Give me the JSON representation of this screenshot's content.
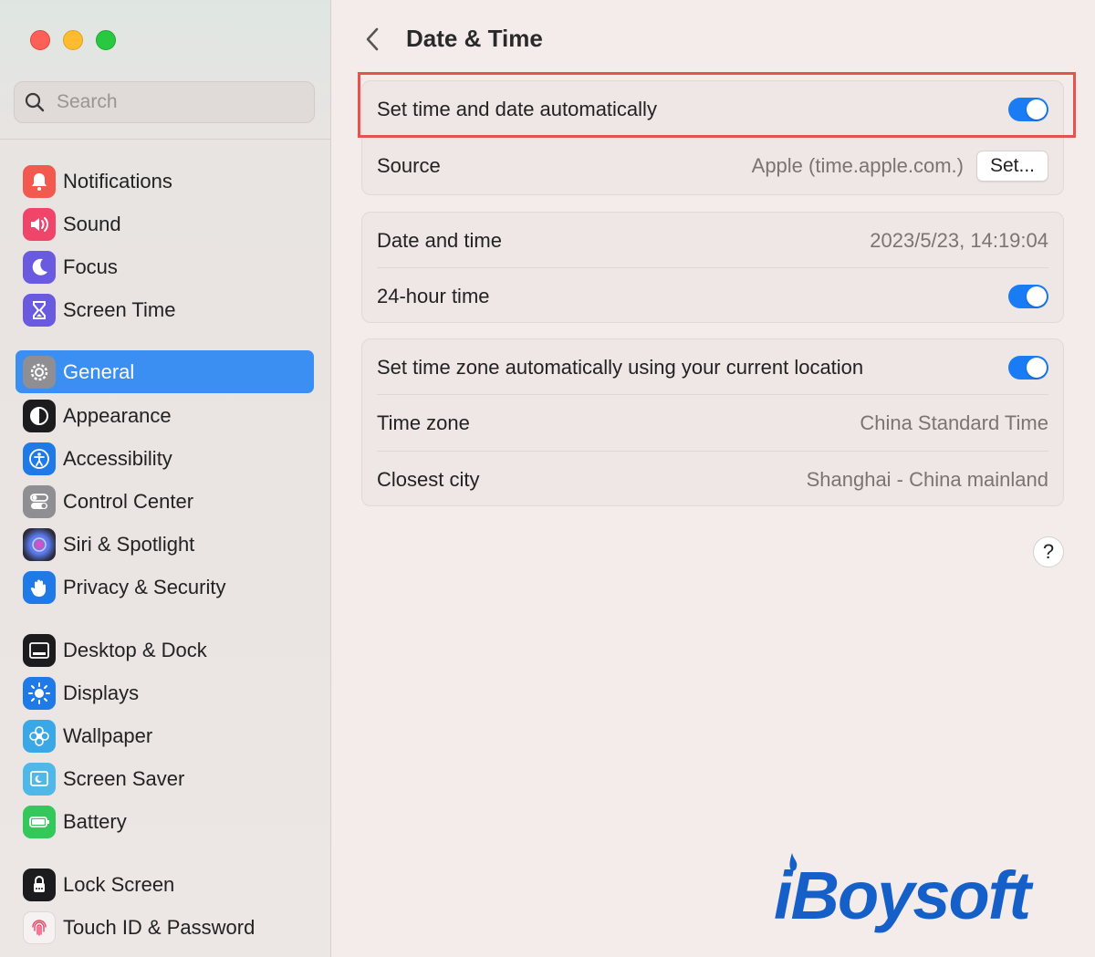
{
  "window": {
    "title": "Date & Time"
  },
  "search": {
    "placeholder": "Search",
    "value": ""
  },
  "sidebar": {
    "items": [
      {
        "label": "Notifications",
        "icon": "bell-icon",
        "color": "#f25a4f"
      },
      {
        "label": "Sound",
        "icon": "speaker-icon",
        "color": "#f0456b"
      },
      {
        "label": "Focus",
        "icon": "moon-icon",
        "color": "#6a5ae0"
      },
      {
        "label": "Screen Time",
        "icon": "hourglass-icon",
        "color": "#6a5ae0"
      },
      {
        "label": "General",
        "icon": "gear-icon",
        "color": "#8e8e93",
        "active": true
      },
      {
        "label": "Appearance",
        "icon": "appearance-icon",
        "color": "#1c1c1e"
      },
      {
        "label": "Accessibility",
        "icon": "accessibility-icon",
        "color": "#1f7ae8"
      },
      {
        "label": "Control Center",
        "icon": "toggles-icon",
        "color": "#8e8e93"
      },
      {
        "label": "Siri & Spotlight",
        "icon": "siri-icon",
        "color": "#2b2b3b"
      },
      {
        "label": "Privacy & Security",
        "icon": "hand-icon",
        "color": "#1f7ae8"
      },
      {
        "label": "Desktop & Dock",
        "icon": "dock-icon",
        "color": "#1c1c1e"
      },
      {
        "label": "Displays",
        "icon": "sun-icon",
        "color": "#1f7ae8"
      },
      {
        "label": "Wallpaper",
        "icon": "flower-icon",
        "color": "#3aa7e6"
      },
      {
        "label": "Screen Saver",
        "icon": "screensaver-icon",
        "color": "#4fb8e8"
      },
      {
        "label": "Battery",
        "icon": "battery-icon",
        "color": "#34c759"
      },
      {
        "label": "Lock Screen",
        "icon": "lock-icon",
        "color": "#1c1c1e"
      },
      {
        "label": "Touch ID & Password",
        "icon": "fingerprint-icon",
        "color": "#f2f2f2"
      }
    ]
  },
  "main": {
    "title": "Date & Time",
    "auto_time": {
      "label": "Set time and date automatically",
      "enabled": true
    },
    "source": {
      "label": "Source",
      "value": "Apple (time.apple.com.)",
      "button": "Set..."
    },
    "date_time": {
      "label": "Date and time",
      "value": "2023/5/23, 14:19:04"
    },
    "hour24": {
      "label": "24-hour time",
      "enabled": true
    },
    "auto_tz": {
      "label": "Set time zone automatically using your current location",
      "enabled": true
    },
    "timezone": {
      "label": "Time zone",
      "value": "China Standard Time"
    },
    "city": {
      "label": "Closest city",
      "value": "Shanghai - China mainland"
    },
    "help": "?"
  },
  "watermark": {
    "text": "iBoysoft",
    "color": "#1560c8"
  },
  "colors": {
    "accent": "#1a7cf4",
    "highlight": "#e4544f"
  }
}
